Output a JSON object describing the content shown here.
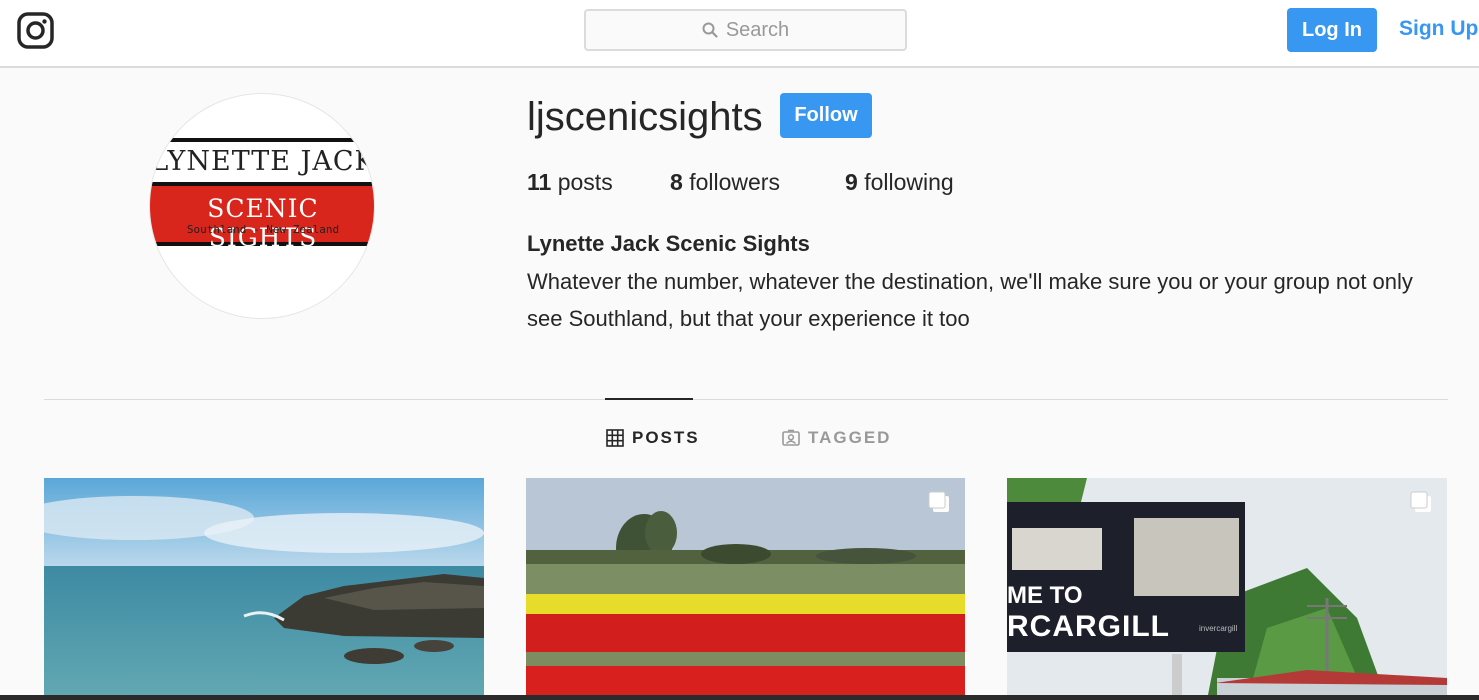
{
  "header": {
    "search_placeholder": "Search",
    "login_label": "Log In",
    "signup_label": "Sign Up"
  },
  "profile": {
    "username": "ljscenicsights",
    "follow_label": "Follow",
    "avatar_text": {
      "line1": "LYNETTE JACK",
      "line2": "SCENIC SIGHTS",
      "line3": "Southland - New Zealand"
    },
    "stats": {
      "posts_count": "11",
      "posts_label": "posts",
      "followers_count": "8",
      "followers_label": "followers",
      "following_count": "9",
      "following_label": "following"
    },
    "full_name": "Lynette Jack Scenic Sights",
    "bio": "Whatever the number, whatever the destination, we'll make sure you or your group not only see Southland, but that your experience it too"
  },
  "tabs": [
    {
      "label": "POSTS",
      "icon": "grid-icon",
      "active": true
    },
    {
      "label": "TAGGED",
      "icon": "tagged-icon",
      "active": false
    }
  ],
  "post_overlay": {
    "sign_text_1": "ME TO",
    "sign_text_2": "RCARGILL",
    "sign_logo_text": "invercargill"
  },
  "colors": {
    "accent": "#3897f0",
    "logo_red": "#d9261c"
  }
}
